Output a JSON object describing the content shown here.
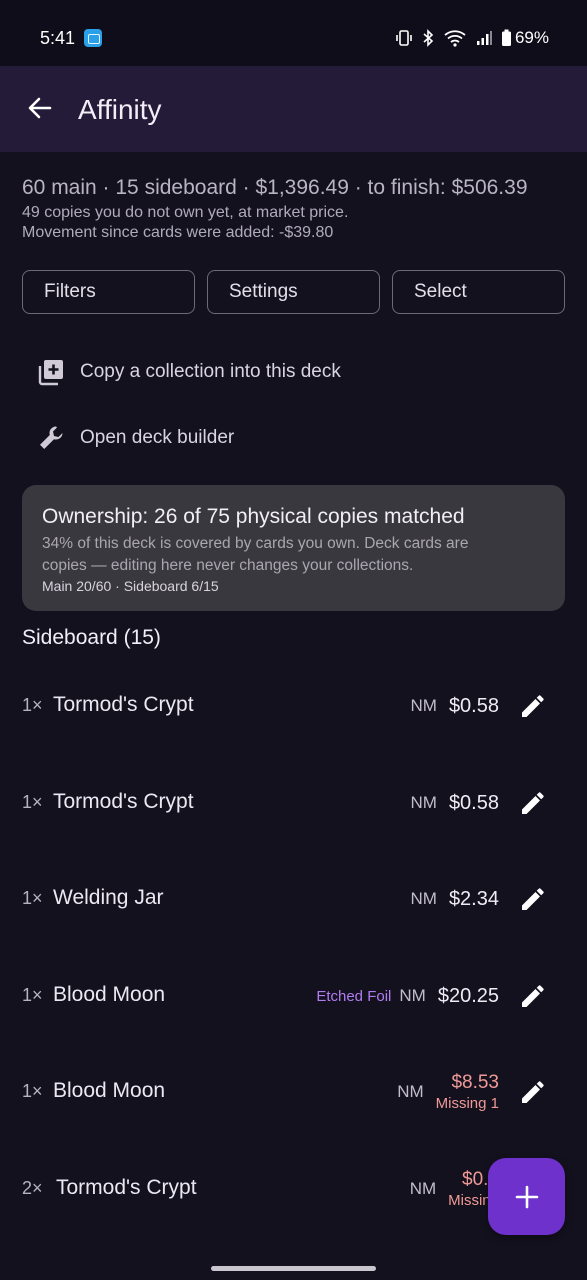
{
  "status_bar": {
    "time": "5:41",
    "battery": "69%",
    "icons": [
      "app-notification-icon",
      "vibrate-icon",
      "bluetooth-icon",
      "wifi-icon",
      "signal-icon",
      "battery-icon"
    ]
  },
  "app_bar": {
    "back_icon": "arrow-back-icon",
    "title": "Affinity"
  },
  "summary": {
    "main": "60 main · 15 sideboard · $1,396.49 · to finish: $506.39",
    "line1": "49 copies you do not own yet, at market price.",
    "line2": "Movement since cards were added: -$39.80"
  },
  "buttons": {
    "filters": "Filters",
    "settings": "Settings",
    "select": "Select"
  },
  "actions": {
    "copy_collection": "Copy a collection into this deck",
    "copy_icon": "library-add-icon",
    "open_builder": "Open deck builder",
    "builder_icon": "wrench-icon"
  },
  "ownership": {
    "title": "Ownership: 26 of 75 physical copies matched",
    "desc_line1": "34% of this deck is covered by cards you own. Deck cards are",
    "desc_line2": "copies — editing here never changes your collections.",
    "breakdown": "Main 20/60 · Sideboard 6/15"
  },
  "section": {
    "title": "Sideboard (15)"
  },
  "cards": [
    {
      "qty": "1×",
      "name": "Tormod's Crypt",
      "foil": "",
      "cond": "NM",
      "price": "$0.58",
      "missing": ""
    },
    {
      "qty": "1×",
      "name": "Tormod's Crypt",
      "foil": "",
      "cond": "NM",
      "price": "$0.58",
      "missing": ""
    },
    {
      "qty": "1×",
      "name": "Welding Jar",
      "foil": "",
      "cond": "NM",
      "price": "$2.34",
      "missing": ""
    },
    {
      "qty": "1×",
      "name": "Blood Moon",
      "foil": "Etched Foil",
      "cond": "NM",
      "price": "$20.25",
      "missing": ""
    },
    {
      "qty": "1×",
      "name": "Blood Moon",
      "foil": "",
      "cond": "NM",
      "price": "$8.53",
      "missing": "Missing 1"
    },
    {
      "qty": "2×",
      "name": "Tormod's Crypt",
      "foil": "",
      "cond": "NM",
      "price": "$0.8",
      "missing": "Missing"
    }
  ],
  "fab": {
    "icon": "plus-icon"
  },
  "colors": {
    "background": "#14111f",
    "app_bar": "#231b38",
    "accent": "#6e31cc",
    "missing": "#ef9a96",
    "foil": "#b07cf0"
  }
}
